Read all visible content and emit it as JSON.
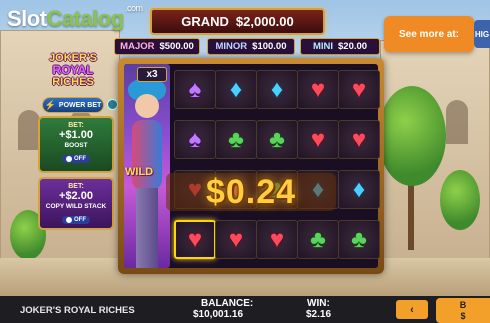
{
  "brand": {
    "name_part1": "Slot",
    "name_part2": "Catalog",
    "tld": ".com"
  },
  "jackpots": {
    "grand": {
      "label": "GRAND",
      "value": "$2,000.00"
    },
    "major": {
      "label": "MAJOR",
      "value": "$500.00"
    },
    "minor": {
      "label": "MINOR",
      "value": "$100.00"
    },
    "mini": {
      "label": "MINI",
      "value": "$20.00"
    }
  },
  "cta": {
    "see_more": "See more at:",
    "edge_label": "HIG"
  },
  "game_logo": {
    "line1": "JOKER'S",
    "line2": "ROYAL",
    "line3": "RICHES"
  },
  "power_bet": {
    "label": "POWER BET",
    "bolt": "⚡"
  },
  "bet_boost": {
    "title": "BET:",
    "amount": "+$1.00",
    "sub": "BOOST",
    "toggle": "OFF"
  },
  "bet_stack": {
    "title": "BET:",
    "amount": "+$2.00",
    "sub": "COPY WILD STACK",
    "toggle": "OFF"
  },
  "reels": {
    "multiplier": "x3",
    "wild_label": "WILD",
    "grid": [
      [
        "spade",
        "diamond",
        "diamond",
        "heart",
        "heart"
      ],
      [
        "spade",
        "club",
        "club",
        "heart",
        "heart"
      ],
      [
        "heart",
        "heart",
        "club",
        "diamond",
        "diamond"
      ],
      [
        "heart",
        "heart",
        "heart",
        "club",
        "club"
      ]
    ],
    "win_display": "$0.24"
  },
  "footer": {
    "title": "JOKER'S ROYAL RICHES",
    "balance_label": "BALANCE:",
    "balance_value": "$10,001.16",
    "win_label": "WIN:",
    "win_value": "$2.16",
    "prev_button": "‹",
    "right_button_top": "B",
    "right_button_bottom": "$"
  },
  "symbols": {
    "heart": "♥",
    "spade": "♠",
    "diamond": "♦",
    "club": "♣"
  }
}
